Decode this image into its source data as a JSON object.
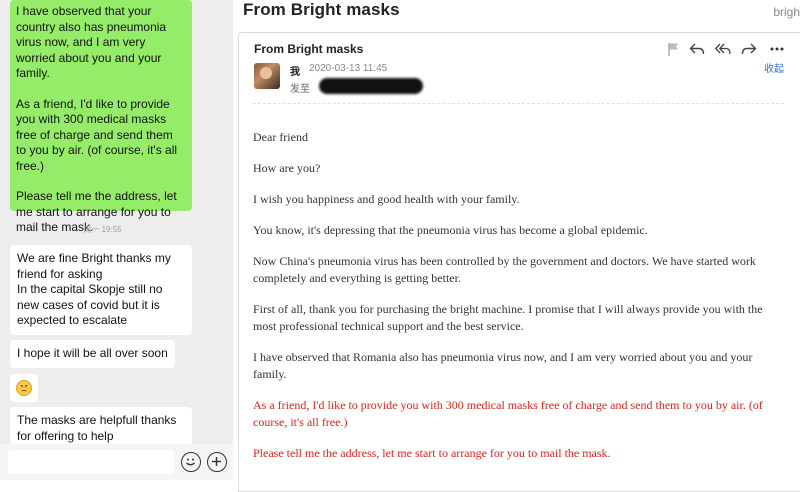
{
  "chat": {
    "sent_message": {
      "paragraphs": [
        "I have observed that your country also has pneumonia virus now, and I am very worried about you and your family.",
        "As a friend, I'd like to provide you with 300 medical masks free of charge and send them to you by air. (of course, it's all free.)",
        "Please tell me the address, let me start to arrange for you to mail the mask."
      ]
    },
    "timestamp": "周一 19:55",
    "received_messages": [
      "We are fine Bright thanks my friend for asking\nIn the capital Skopje still no new cases of covid but it is expected to escalate",
      "I hope it will be all over soon",
      "The masks are helpfull thanks for offering to help"
    ],
    "emoji_icon": "slightly-smiling-face"
  },
  "mail": {
    "header_title": "From Bright masks",
    "header_brand": "brigh",
    "subject": "From Bright masks",
    "sender": "我",
    "sent_time": "2020-03-13 11:45",
    "to_label": "发至",
    "collapse_label": "收起",
    "toolbar_icons": [
      "flag-icon",
      "reply-icon",
      "reply-all-icon",
      "forward-icon",
      "more-icon"
    ],
    "body": [
      {
        "text": "Dear friend",
        "style": "normal"
      },
      {
        "text": "How are you?",
        "style": "normal"
      },
      {
        "text": "I wish you happiness and good health with your family.",
        "style": "normal"
      },
      {
        "text": "You know, it's depressing that the pneumonia virus has become a global epidemic.",
        "style": "normal"
      },
      {
        "text": "Now China's pneumonia virus has been controlled by the government and doctors. We have started work completely and everything is getting better.",
        "style": "normal"
      },
      {
        "text": "First of all, thank you for purchasing the bright machine. I promise that I will always provide you with the most professional technical support and the best service.",
        "style": "normal"
      },
      {
        "text": "I have observed that Romania also has pneumonia virus now, and I am very worried about you and your family.",
        "style": "normal"
      },
      {
        "text": "As a friend, I'd like to provide you with 300 medical masks free of charge and send them to you by air. (of course, it's all free.)",
        "style": "red"
      },
      {
        "text": "Please tell me the address, let me start to arrange for you to mail the mask.",
        "style": "red"
      }
    ],
    "accent_color": "#d9261c",
    "link_color": "#2c6fd1"
  },
  "colors": {
    "sent_bubble": "#95ec69",
    "chat_background": "#ededed"
  }
}
